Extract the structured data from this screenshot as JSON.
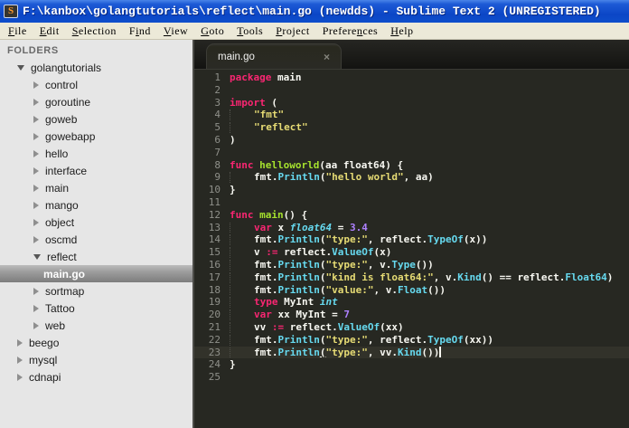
{
  "window": {
    "title": "F:\\kanbox\\golangtutorials\\reflect\\main.go (newdds) - Sublime Text 2 (UNREGISTERED)",
    "app_icon_glyph": "S"
  },
  "menu": {
    "items": [
      {
        "label": "File",
        "mnemonic": 0
      },
      {
        "label": "Edit",
        "mnemonic": 0
      },
      {
        "label": "Selection",
        "mnemonic": 0
      },
      {
        "label": "Find",
        "mnemonic": 1
      },
      {
        "label": "View",
        "mnemonic": 0
      },
      {
        "label": "Goto",
        "mnemonic": 0
      },
      {
        "label": "Tools",
        "mnemonic": 0
      },
      {
        "label": "Project",
        "mnemonic": 0
      },
      {
        "label": "Preferences",
        "mnemonic": 7
      },
      {
        "label": "Help",
        "mnemonic": 0
      }
    ]
  },
  "sidebar": {
    "header": "FOLDERS",
    "items": [
      {
        "label": "golangtutorials",
        "level": 0,
        "state": "expanded",
        "selected": false
      },
      {
        "label": "control",
        "level": 1,
        "state": "collapsed",
        "selected": false
      },
      {
        "label": "goroutine",
        "level": 1,
        "state": "collapsed",
        "selected": false
      },
      {
        "label": "goweb",
        "level": 1,
        "state": "collapsed",
        "selected": false
      },
      {
        "label": "gowebapp",
        "level": 1,
        "state": "collapsed",
        "selected": false
      },
      {
        "label": "hello",
        "level": 1,
        "state": "collapsed",
        "selected": false
      },
      {
        "label": "interface",
        "level": 1,
        "state": "collapsed",
        "selected": false
      },
      {
        "label": "main",
        "level": 1,
        "state": "collapsed",
        "selected": false
      },
      {
        "label": "mango",
        "level": 1,
        "state": "collapsed",
        "selected": false
      },
      {
        "label": "object",
        "level": 1,
        "state": "collapsed",
        "selected": false
      },
      {
        "label": "oscmd",
        "level": 1,
        "state": "collapsed",
        "selected": false
      },
      {
        "label": "reflect",
        "level": 1,
        "state": "expanded",
        "selected": false
      },
      {
        "label": "main.go",
        "level": 2,
        "state": "file",
        "selected": true
      },
      {
        "label": "sortmap",
        "level": 1,
        "state": "collapsed",
        "selected": false
      },
      {
        "label": "Tattoo",
        "level": 1,
        "state": "collapsed",
        "selected": false
      },
      {
        "label": "web",
        "level": 1,
        "state": "collapsed",
        "selected": false
      },
      {
        "label": "beego",
        "level": 0,
        "state": "collapsed",
        "selected": false
      },
      {
        "label": "mysql",
        "level": 0,
        "state": "collapsed",
        "selected": false
      },
      {
        "label": "cdnapi",
        "level": 0,
        "state": "collapsed",
        "selected": false
      }
    ]
  },
  "tabs": [
    {
      "label": "main.go",
      "close": "×",
      "active": true
    }
  ],
  "code": {
    "language": "go",
    "active_line": 23,
    "lines": [
      {
        "n": 1,
        "indent": 0,
        "tokens": [
          [
            "kw",
            "package"
          ],
          [
            "pl",
            " main"
          ]
        ]
      },
      {
        "n": 2,
        "indent": 0,
        "tokens": []
      },
      {
        "n": 3,
        "indent": 0,
        "tokens": [
          [
            "kw",
            "import"
          ],
          [
            "pl",
            " ("
          ]
        ]
      },
      {
        "n": 4,
        "indent": 1,
        "tokens": [
          [
            "str",
            "\"fmt\""
          ]
        ]
      },
      {
        "n": 5,
        "indent": 1,
        "tokens": [
          [
            "str",
            "\"reflect\""
          ]
        ]
      },
      {
        "n": 6,
        "indent": 0,
        "tokens": [
          [
            "pl",
            ")"
          ]
        ]
      },
      {
        "n": 7,
        "indent": 0,
        "tokens": []
      },
      {
        "n": 8,
        "indent": 0,
        "tokens": [
          [
            "kw",
            "func"
          ],
          [
            "pl",
            " "
          ],
          [
            "fn",
            "helloworld"
          ],
          [
            "pl",
            "(aa float64) {"
          ]
        ]
      },
      {
        "n": 9,
        "indent": 1,
        "tokens": [
          [
            "pl",
            "fmt."
          ],
          [
            "call",
            "Println"
          ],
          [
            "pl",
            "("
          ],
          [
            "str",
            "\"hello world\""
          ],
          [
            "pl",
            ", aa)"
          ]
        ]
      },
      {
        "n": 10,
        "indent": 0,
        "tokens": [
          [
            "pl",
            "}"
          ]
        ]
      },
      {
        "n": 11,
        "indent": 0,
        "tokens": []
      },
      {
        "n": 12,
        "indent": 0,
        "tokens": [
          [
            "kw",
            "func"
          ],
          [
            "pl",
            " "
          ],
          [
            "fn",
            "main"
          ],
          [
            "pl",
            "() {"
          ]
        ]
      },
      {
        "n": 13,
        "indent": 1,
        "tokens": [
          [
            "kw",
            "var"
          ],
          [
            "pl",
            " x "
          ],
          [
            "typ",
            "float64"
          ],
          [
            "pl",
            " = "
          ],
          [
            "num",
            "3.4"
          ]
        ]
      },
      {
        "n": 14,
        "indent": 1,
        "tokens": [
          [
            "pl",
            "fmt."
          ],
          [
            "call",
            "Println"
          ],
          [
            "pl",
            "("
          ],
          [
            "str",
            "\"type:\""
          ],
          [
            "pl",
            ", reflect."
          ],
          [
            "call",
            "TypeOf"
          ],
          [
            "pl",
            "(x))"
          ]
        ]
      },
      {
        "n": 15,
        "indent": 1,
        "tokens": [
          [
            "pl",
            "v "
          ],
          [
            "kw",
            ":="
          ],
          [
            "pl",
            " reflect."
          ],
          [
            "call",
            "ValueOf"
          ],
          [
            "pl",
            "(x)"
          ]
        ]
      },
      {
        "n": 16,
        "indent": 1,
        "tokens": [
          [
            "pl",
            "fmt."
          ],
          [
            "call",
            "Println"
          ],
          [
            "pl",
            "("
          ],
          [
            "str",
            "\"type:\""
          ],
          [
            "pl",
            ", v."
          ],
          [
            "call",
            "Type"
          ],
          [
            "pl",
            "())"
          ]
        ]
      },
      {
        "n": 17,
        "indent": 1,
        "tokens": [
          [
            "pl",
            "fmt."
          ],
          [
            "call",
            "Println"
          ],
          [
            "pl",
            "("
          ],
          [
            "str",
            "\"kind is float64:\""
          ],
          [
            "pl",
            ", v."
          ],
          [
            "call",
            "Kind"
          ],
          [
            "pl",
            "() == reflect."
          ],
          [
            "call",
            "Float64"
          ],
          [
            "pl",
            ")"
          ]
        ]
      },
      {
        "n": 18,
        "indent": 1,
        "tokens": [
          [
            "pl",
            "fmt."
          ],
          [
            "call",
            "Println"
          ],
          [
            "pl",
            "("
          ],
          [
            "str",
            "\"value:\""
          ],
          [
            "pl",
            ", v."
          ],
          [
            "call",
            "Float"
          ],
          [
            "pl",
            "())"
          ]
        ]
      },
      {
        "n": 19,
        "indent": 1,
        "tokens": [
          [
            "kw",
            "type"
          ],
          [
            "pl",
            " MyInt "
          ],
          [
            "typ",
            "int"
          ]
        ]
      },
      {
        "n": 20,
        "indent": 1,
        "tokens": [
          [
            "kw",
            "var"
          ],
          [
            "pl",
            " xx MyInt = "
          ],
          [
            "num",
            "7"
          ]
        ]
      },
      {
        "n": 21,
        "indent": 1,
        "tokens": [
          [
            "pl",
            "vv "
          ],
          [
            "kw",
            ":="
          ],
          [
            "pl",
            " reflect."
          ],
          [
            "call",
            "ValueOf"
          ],
          [
            "pl",
            "(xx)"
          ]
        ]
      },
      {
        "n": 22,
        "indent": 1,
        "tokens": [
          [
            "pl",
            "fmt."
          ],
          [
            "call",
            "Println"
          ],
          [
            "pl",
            "("
          ],
          [
            "str",
            "\"type:\""
          ],
          [
            "pl",
            ", reflect."
          ],
          [
            "call",
            "TypeOf"
          ],
          [
            "pl",
            "(xx))"
          ]
        ]
      },
      {
        "n": 23,
        "indent": 1,
        "caret": true,
        "tokens": [
          [
            "pl",
            "fmt."
          ],
          [
            "call",
            "Println"
          ],
          [
            "plu",
            "("
          ],
          [
            "str",
            "\"type:\""
          ],
          [
            "pl",
            ", vv."
          ],
          [
            "call",
            "Kind"
          ],
          [
            "pl",
            "())"
          ]
        ]
      },
      {
        "n": 24,
        "indent": 0,
        "tokens": [
          [
            "pl",
            "}"
          ]
        ]
      },
      {
        "n": 25,
        "indent": 0,
        "tokens": []
      }
    ]
  },
  "colors": {
    "titlebar": "#0d47c8",
    "menubar": "#ece9d8",
    "sidebar_bg": "#e6e6e6",
    "sidebar_sel": "#8a8a8a",
    "editor_bg": "#272822",
    "tabbar": "#1a1a17",
    "gutter": "#8f908a",
    "active_line": "#32322a",
    "kw": "#f92672",
    "fn": "#a6e22e",
    "str": "#e6db74",
    "call": "#66d9ef",
    "typ": "#66d9ef",
    "num": "#ae81ff",
    "plain": "#f8f8f2"
  }
}
